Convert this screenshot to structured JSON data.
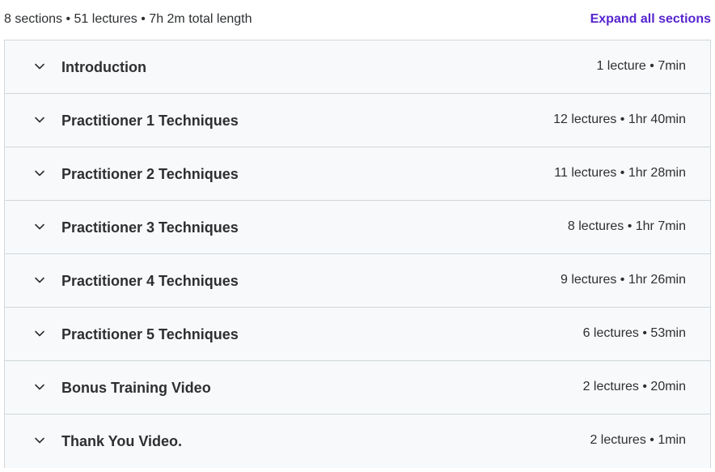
{
  "summary": {
    "text": "8 sections • 51 lectures • 7h 2m total length",
    "expand_label": "Expand all sections"
  },
  "sections": [
    {
      "title": "Introduction",
      "meta": "1 lecture • 7min",
      "icon": "chevron-down-icon"
    },
    {
      "title": "Practitioner 1 Techniques",
      "meta": "12 lectures • 1hr 40min",
      "icon": "chevron-down-icon"
    },
    {
      "title": "Practitioner 2 Techniques",
      "meta": "11 lectures • 1hr 28min",
      "icon": "chevron-down-icon"
    },
    {
      "title": "Practitioner 3 Techniques",
      "meta": "8 lectures • 1hr 7min",
      "icon": "chevron-down-icon"
    },
    {
      "title": "Practitioner 4 Techniques",
      "meta": "9 lectures • 1hr 26min",
      "icon": "chevron-down-icon"
    },
    {
      "title": "Practitioner 5 Techniques",
      "meta": "6 lectures • 53min",
      "icon": "chevron-down-icon"
    },
    {
      "title": "Bonus Training Video",
      "meta": "2 lectures • 20min",
      "icon": "chevron-down-icon"
    },
    {
      "title": "Thank You Video.",
      "meta": "2 lectures • 1min",
      "icon": "chevron-down-icon"
    }
  ],
  "colors": {
    "accent": "#5624d0",
    "row_background": "#f7f9fa",
    "border": "#d1d7dc",
    "text": "#2d2f31"
  }
}
